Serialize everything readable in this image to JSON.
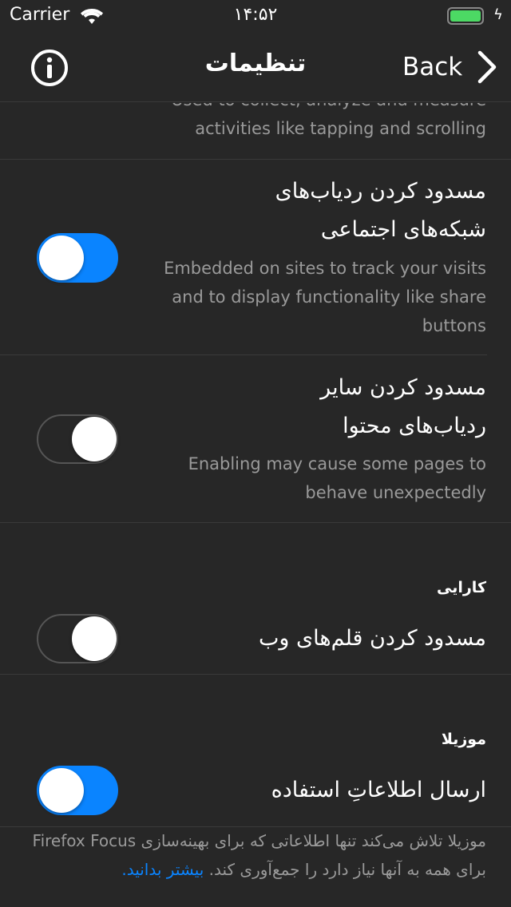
{
  "status": {
    "carrier": "Carrier",
    "time": "۱۴:۵۲",
    "battery_color": "#4cd964"
  },
  "nav": {
    "title": "تنظیمات",
    "back_label": "Back",
    "info_icon": "info-icon"
  },
  "rows": [
    {
      "desc": [
        "Used to collect, analyze and measure",
        "activities like tapping and scrolling"
      ]
    },
    {
      "title": [
        "مسدود کردن ردیاب‌های",
        "شبکه‌های اجتماعی"
      ],
      "desc": [
        "Embedded on sites to track your visits",
        "and to display functionality like share",
        "buttons"
      ],
      "on": true
    },
    {
      "title": [
        "مسدود کردن سایر",
        "ردیاب‌های محتوا"
      ],
      "desc": [
        "Enabling may cause some pages to",
        "behave unexpectedly"
      ],
      "on": false
    }
  ],
  "performance": {
    "header": "کارایی",
    "row_title": "مسدود کردن قلم‌های وب",
    "on": false
  },
  "mozilla": {
    "header": "موزیلا",
    "row_title": "ارسال اطلاعاتِ استفاده",
    "on": true,
    "footer_1": "موزیلا تلاش می‌کند تنها اطلاعاتی که برای بهینه‌سازی Firefox Focus برای همه به آنها نیاز دارد را جمع‌آوری کند.",
    "footer_link": "بیشتر بدانید."
  },
  "accent": "#0a84ff"
}
